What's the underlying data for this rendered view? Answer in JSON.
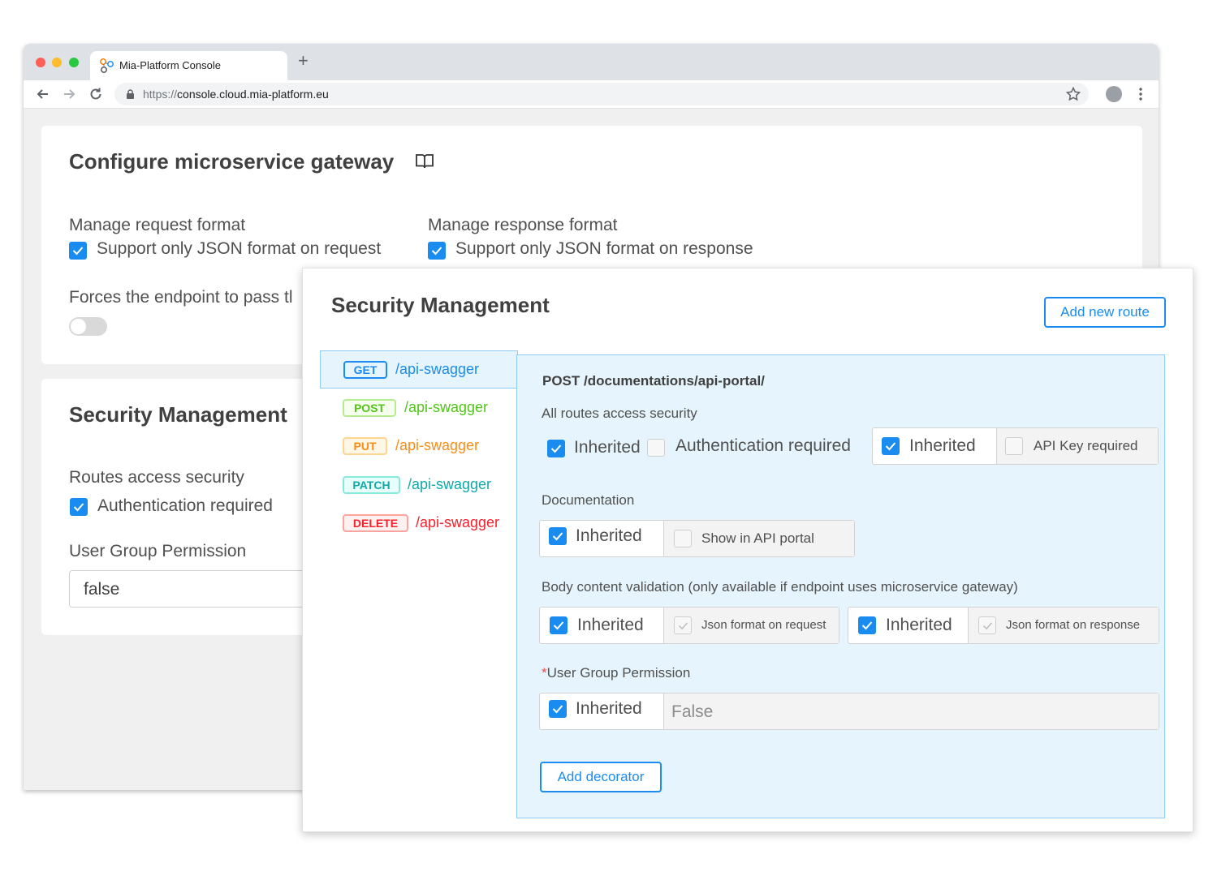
{
  "browser": {
    "tab_title": "Mia-Platform Console",
    "url_protocol": "https://",
    "url_host": "console.cloud.mia-platform.eu"
  },
  "background": {
    "gateway": {
      "title": "Configure microservice gateway",
      "request_label": "Manage request format",
      "request_checkbox": "Support only JSON format on request",
      "response_label": "Manage response format",
      "response_checkbox": "Support only JSON format on response",
      "forces_label": "Forces the endpoint to pass tl"
    },
    "security": {
      "title": "Security Management",
      "routes_label": "Routes access security",
      "auth_checkbox": "Authentication required",
      "group_label": "User Group Permission",
      "group_value": "false"
    }
  },
  "panel": {
    "title": "Security Management",
    "add_route_label": "Add new route",
    "routes": [
      {
        "method": "GET",
        "path": "/api-swagger",
        "color": "#1a8cf0",
        "bg": "#e6f4fd"
      },
      {
        "method": "POST",
        "path": "/api-swagger",
        "color": "#52c41a",
        "bg": "#f6ffed"
      },
      {
        "method": "PUT",
        "path": "/api-swagger",
        "color": "#fa8c16",
        "bg": "#fff7e6"
      },
      {
        "method": "PATCH",
        "path": "/api-swagger",
        "color": "#13a8a8",
        "bg": "#e6fffb"
      },
      {
        "method": "DELETE",
        "path": "/api-swagger",
        "color": "#f5222d",
        "bg": "#fff1f0"
      }
    ],
    "detail": {
      "title": "POST /documentations/api-portal/",
      "access_label": "All routes access security",
      "inherited": "Inherited",
      "auth_required": "Authentication required",
      "api_key_required": "API Key required",
      "documentation_label": "Documentation",
      "show_in_portal": "Show in API portal",
      "body_label": "Body content validation (only available if endpoint uses microservice gateway)",
      "json_request": "Json format on request",
      "json_response": "Json format on response",
      "required_mark": "*",
      "group_label": "User Group Permission",
      "group_value": "False",
      "add_decorator_label": "Add decorator"
    }
  },
  "colors": {
    "accent": "#1a8cf0",
    "selected_bg": "#e6f4fd"
  }
}
